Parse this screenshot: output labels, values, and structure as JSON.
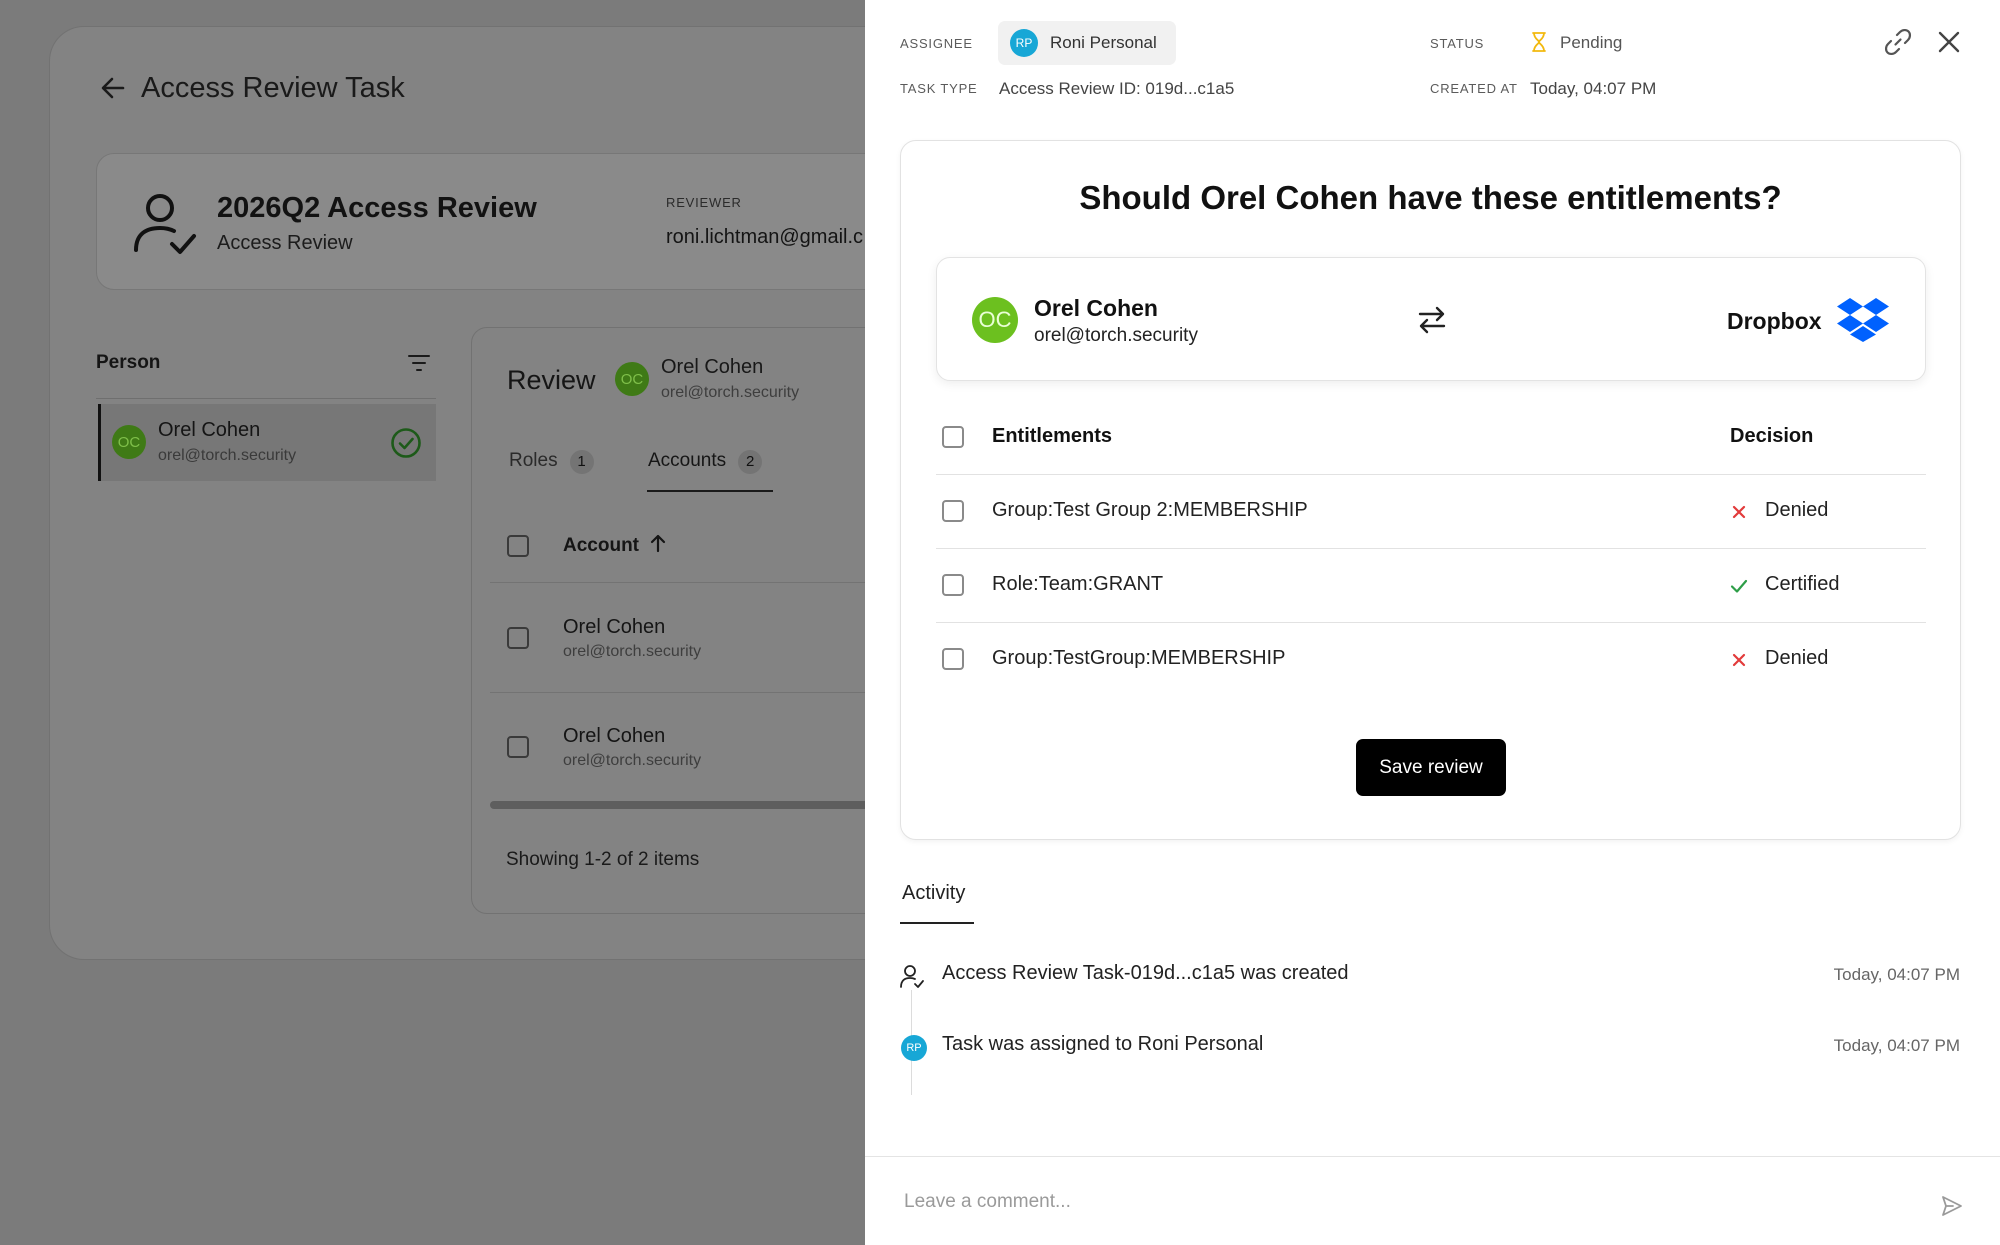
{
  "background": {
    "page_title": "Access Review Task",
    "review_card": {
      "title": "2026Q2 Access Review",
      "subtitle": "Access Review",
      "reviewer_label": "REVIEWER",
      "reviewer_value": "roni.lichtman@gmail.c"
    },
    "person_panel": {
      "header": "Person",
      "row": {
        "initials": "OC",
        "name": "Orel Cohen",
        "email": "orel@torch.security"
      }
    },
    "review_panel": {
      "label": "Review",
      "person": {
        "initials": "OC",
        "name": "Orel Cohen",
        "email": "orel@torch.security"
      },
      "tabs": [
        {
          "label": "Roles",
          "count": "1"
        },
        {
          "label": "Accounts",
          "count": "2"
        }
      ],
      "column_header": "Account",
      "rows": [
        {
          "name": "Orel Cohen",
          "email": "orel@torch.security"
        },
        {
          "name": "Orel Cohen",
          "email": "orel@torch.security"
        }
      ],
      "showing": "Showing 1-2 of 2 items"
    }
  },
  "drawer": {
    "assignee_label": "ASSIGNEE",
    "assignee": {
      "initials": "RP",
      "name": "Roni Personal"
    },
    "task_type_label": "TASK TYPE",
    "task_type_value": "Access Review ID: 019d...c1a5",
    "status_label": "STATUS",
    "status_value": "Pending",
    "created_at_label": "CREATED AT",
    "created_at_value": "Today, 04:07 PM",
    "question": "Should Orel Cohen have these entitlements?",
    "pair": {
      "initials": "OC",
      "name": "Orel Cohen",
      "email": "orel@torch.security",
      "app": "Dropbox"
    },
    "table": {
      "entitlements_header": "Entitlements",
      "decision_header": "Decision",
      "rows": [
        {
          "entitlement": "Group:Test Group 2:MEMBERSHIP",
          "decision": "Denied"
        },
        {
          "entitlement": "Role:Team:GRANT",
          "decision": "Certified"
        },
        {
          "entitlement": "Group:TestGroup:MEMBERSHIP",
          "decision": "Denied"
        }
      ]
    },
    "save_label": "Save review",
    "activity_tab": "Activity",
    "activity": [
      {
        "text": "Access Review Task-019d...c1a5 was created",
        "time": "Today, 04:07 PM"
      },
      {
        "initials": "RP",
        "text": "Task was assigned to Roni Personal",
        "time": "Today, 04:07 PM"
      }
    ],
    "comment_placeholder": "Leave a comment..."
  },
  "colors": {
    "oc_avatar": "#6cc01f",
    "rp_avatar": "#17a7d6",
    "pending": "#f2b90f",
    "denied": "#e23b3b",
    "certified": "#2e9e48",
    "dropbox": "#0061fe"
  },
  "icons": [
    "arrow-left-icon",
    "user-check-icon",
    "filter-icon",
    "check-circle-icon",
    "sort-arrow-up-icon",
    "hourglass-icon",
    "link-icon",
    "close-icon",
    "swap-arrows-icon",
    "dropbox-logo",
    "x-icon",
    "check-icon",
    "send-icon"
  ]
}
